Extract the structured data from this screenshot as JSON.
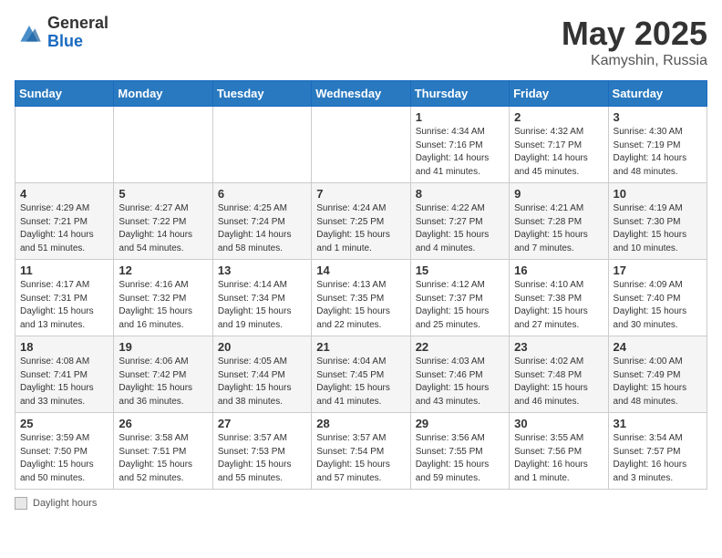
{
  "header": {
    "logo_general": "General",
    "logo_blue": "Blue",
    "title_month": "May 2025",
    "title_location": "Kamyshin, Russia"
  },
  "weekdays": [
    "Sunday",
    "Monday",
    "Tuesday",
    "Wednesday",
    "Thursday",
    "Friday",
    "Saturday"
  ],
  "weeks": [
    [
      {
        "day": "",
        "info": ""
      },
      {
        "day": "",
        "info": ""
      },
      {
        "day": "",
        "info": ""
      },
      {
        "day": "",
        "info": ""
      },
      {
        "day": "1",
        "info": "Sunrise: 4:34 AM\nSunset: 7:16 PM\nDaylight: 14 hours\nand 41 minutes."
      },
      {
        "day": "2",
        "info": "Sunrise: 4:32 AM\nSunset: 7:17 PM\nDaylight: 14 hours\nand 45 minutes."
      },
      {
        "day": "3",
        "info": "Sunrise: 4:30 AM\nSunset: 7:19 PM\nDaylight: 14 hours\nand 48 minutes."
      }
    ],
    [
      {
        "day": "4",
        "info": "Sunrise: 4:29 AM\nSunset: 7:21 PM\nDaylight: 14 hours\nand 51 minutes."
      },
      {
        "day": "5",
        "info": "Sunrise: 4:27 AM\nSunset: 7:22 PM\nDaylight: 14 hours\nand 54 minutes."
      },
      {
        "day": "6",
        "info": "Sunrise: 4:25 AM\nSunset: 7:24 PM\nDaylight: 14 hours\nand 58 minutes."
      },
      {
        "day": "7",
        "info": "Sunrise: 4:24 AM\nSunset: 7:25 PM\nDaylight: 15 hours\nand 1 minute."
      },
      {
        "day": "8",
        "info": "Sunrise: 4:22 AM\nSunset: 7:27 PM\nDaylight: 15 hours\nand 4 minutes."
      },
      {
        "day": "9",
        "info": "Sunrise: 4:21 AM\nSunset: 7:28 PM\nDaylight: 15 hours\nand 7 minutes."
      },
      {
        "day": "10",
        "info": "Sunrise: 4:19 AM\nSunset: 7:30 PM\nDaylight: 15 hours\nand 10 minutes."
      }
    ],
    [
      {
        "day": "11",
        "info": "Sunrise: 4:17 AM\nSunset: 7:31 PM\nDaylight: 15 hours\nand 13 minutes."
      },
      {
        "day": "12",
        "info": "Sunrise: 4:16 AM\nSunset: 7:32 PM\nDaylight: 15 hours\nand 16 minutes."
      },
      {
        "day": "13",
        "info": "Sunrise: 4:14 AM\nSunset: 7:34 PM\nDaylight: 15 hours\nand 19 minutes."
      },
      {
        "day": "14",
        "info": "Sunrise: 4:13 AM\nSunset: 7:35 PM\nDaylight: 15 hours\nand 22 minutes."
      },
      {
        "day": "15",
        "info": "Sunrise: 4:12 AM\nSunset: 7:37 PM\nDaylight: 15 hours\nand 25 minutes."
      },
      {
        "day": "16",
        "info": "Sunrise: 4:10 AM\nSunset: 7:38 PM\nDaylight: 15 hours\nand 27 minutes."
      },
      {
        "day": "17",
        "info": "Sunrise: 4:09 AM\nSunset: 7:40 PM\nDaylight: 15 hours\nand 30 minutes."
      }
    ],
    [
      {
        "day": "18",
        "info": "Sunrise: 4:08 AM\nSunset: 7:41 PM\nDaylight: 15 hours\nand 33 minutes."
      },
      {
        "day": "19",
        "info": "Sunrise: 4:06 AM\nSunset: 7:42 PM\nDaylight: 15 hours\nand 36 minutes."
      },
      {
        "day": "20",
        "info": "Sunrise: 4:05 AM\nSunset: 7:44 PM\nDaylight: 15 hours\nand 38 minutes."
      },
      {
        "day": "21",
        "info": "Sunrise: 4:04 AM\nSunset: 7:45 PM\nDaylight: 15 hours\nand 41 minutes."
      },
      {
        "day": "22",
        "info": "Sunrise: 4:03 AM\nSunset: 7:46 PM\nDaylight: 15 hours\nand 43 minutes."
      },
      {
        "day": "23",
        "info": "Sunrise: 4:02 AM\nSunset: 7:48 PM\nDaylight: 15 hours\nand 46 minutes."
      },
      {
        "day": "24",
        "info": "Sunrise: 4:00 AM\nSunset: 7:49 PM\nDaylight: 15 hours\nand 48 minutes."
      }
    ],
    [
      {
        "day": "25",
        "info": "Sunrise: 3:59 AM\nSunset: 7:50 PM\nDaylight: 15 hours\nand 50 minutes."
      },
      {
        "day": "26",
        "info": "Sunrise: 3:58 AM\nSunset: 7:51 PM\nDaylight: 15 hours\nand 52 minutes."
      },
      {
        "day": "27",
        "info": "Sunrise: 3:57 AM\nSunset: 7:53 PM\nDaylight: 15 hours\nand 55 minutes."
      },
      {
        "day": "28",
        "info": "Sunrise: 3:57 AM\nSunset: 7:54 PM\nDaylight: 15 hours\nand 57 minutes."
      },
      {
        "day": "29",
        "info": "Sunrise: 3:56 AM\nSunset: 7:55 PM\nDaylight: 15 hours\nand 59 minutes."
      },
      {
        "day": "30",
        "info": "Sunrise: 3:55 AM\nSunset: 7:56 PM\nDaylight: 16 hours\nand 1 minute."
      },
      {
        "day": "31",
        "info": "Sunrise: 3:54 AM\nSunset: 7:57 PM\nDaylight: 16 hours\nand 3 minutes."
      }
    ]
  ],
  "footer": {
    "label": "Daylight hours"
  }
}
